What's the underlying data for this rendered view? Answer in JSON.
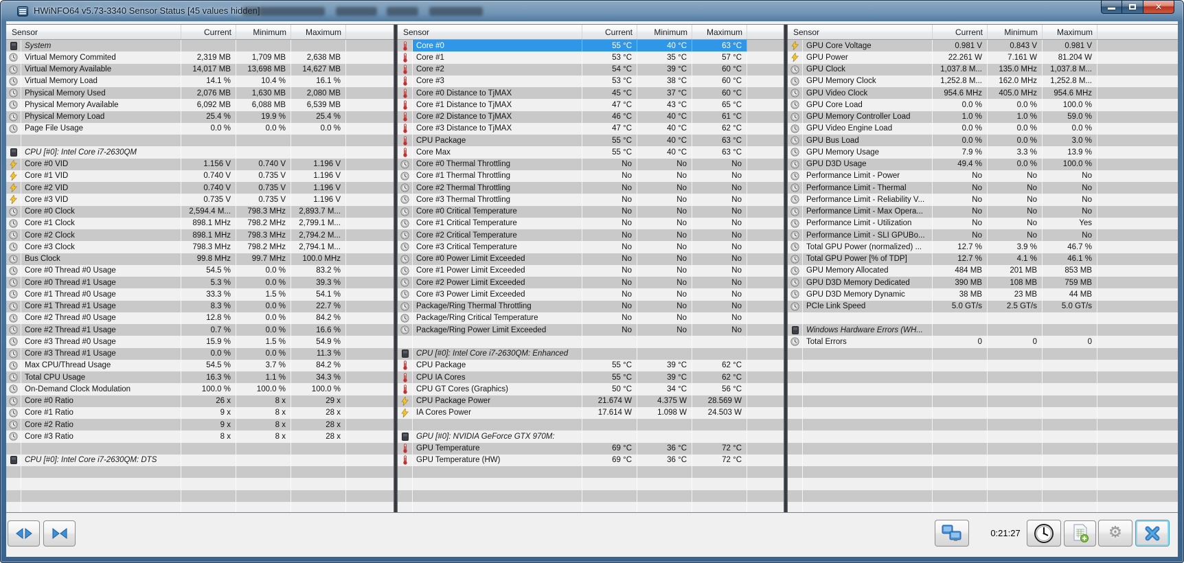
{
  "window": {
    "title": "HWiNFO64 v5.73-3340 Sensor Status [45 values hidden]",
    "controls": {
      "minimize": "minimize",
      "maximize": "maximize",
      "close": "close"
    }
  },
  "columns": {
    "sensor": "Sensor",
    "current": "Current",
    "minimum": "Minimum",
    "maximum": "Maximum"
  },
  "colors": {
    "stripe_light": "#f0f0f0",
    "stripe_dark": "#c9c9c9",
    "selection_blue": "#2f96e8",
    "titlebar_blue": "#47719a",
    "close_button_red": "#b73521",
    "bolt_yellow": "#f6c62d",
    "thermometer_red": "#c2312b"
  },
  "panels": [
    {
      "rows": [
        {
          "t": "h",
          "l": "System"
        },
        {
          "t": "i",
          "ic": "c",
          "l": "Virtual Memory Commited",
          "c": "2,319 MB",
          "m": "1,709 MB",
          "x": "2,638 MB"
        },
        {
          "t": "i",
          "ic": "c",
          "l": "Virtual Memory Available",
          "c": "14,017 MB",
          "m": "13,698 MB",
          "x": "14,627 MB"
        },
        {
          "t": "i",
          "ic": "c",
          "l": "Virtual Memory Load",
          "c": "14.1 %",
          "m": "10.4 %",
          "x": "16.1 %"
        },
        {
          "t": "i",
          "ic": "c",
          "l": "Physical Memory Used",
          "c": "2,076 MB",
          "m": "1,630 MB",
          "x": "2,080 MB"
        },
        {
          "t": "i",
          "ic": "c",
          "l": "Physical Memory Available",
          "c": "6,092 MB",
          "m": "6,088 MB",
          "x": "6,539 MB"
        },
        {
          "t": "i",
          "ic": "c",
          "l": "Physical Memory Load",
          "c": "25.4 %",
          "m": "19.9 %",
          "x": "25.4 %"
        },
        {
          "t": "i",
          "ic": "c",
          "l": "Page File Usage",
          "c": "0.0 %",
          "m": "0.0 %",
          "x": "0.0 %"
        },
        {
          "t": "b"
        },
        {
          "t": "h",
          "l": "CPU [#0]: Intel Core i7-2630QM"
        },
        {
          "t": "i",
          "ic": "b",
          "l": "Core #0 VID",
          "c": "1.156 V",
          "m": "0.740 V",
          "x": "1.196 V"
        },
        {
          "t": "i",
          "ic": "b",
          "l": "Core #1 VID",
          "c": "0.740 V",
          "m": "0.735 V",
          "x": "1.196 V"
        },
        {
          "t": "i",
          "ic": "b",
          "l": "Core #2 VID",
          "c": "0.740 V",
          "m": "0.735 V",
          "x": "1.196 V"
        },
        {
          "t": "i",
          "ic": "b",
          "l": "Core #3 VID",
          "c": "0.735 V",
          "m": "0.735 V",
          "x": "1.196 V"
        },
        {
          "t": "i",
          "ic": "c",
          "l": "Core #0 Clock",
          "c": "2,594.4 M...",
          "m": "798.3 MHz",
          "x": "2,893.7 M..."
        },
        {
          "t": "i",
          "ic": "c",
          "l": "Core #1 Clock",
          "c": "898.1 MHz",
          "m": "798.2 MHz",
          "x": "2,799.1 M..."
        },
        {
          "t": "i",
          "ic": "c",
          "l": "Core #2 Clock",
          "c": "898.1 MHz",
          "m": "798.3 MHz",
          "x": "2,794.2 M..."
        },
        {
          "t": "i",
          "ic": "c",
          "l": "Core #3 Clock",
          "c": "798.3 MHz",
          "m": "798.2 MHz",
          "x": "2,794.1 M..."
        },
        {
          "t": "i",
          "ic": "c",
          "l": "Bus Clock",
          "c": "99.8 MHz",
          "m": "99.7 MHz",
          "x": "100.0 MHz"
        },
        {
          "t": "i",
          "ic": "c",
          "l": "Core #0 Thread #0 Usage",
          "c": "54.5 %",
          "m": "0.0 %",
          "x": "83.2 %"
        },
        {
          "t": "i",
          "ic": "c",
          "l": "Core #0 Thread #1 Usage",
          "c": "5.3 %",
          "m": "0.0 %",
          "x": "39.3 %"
        },
        {
          "t": "i",
          "ic": "c",
          "l": "Core #1 Thread #0 Usage",
          "c": "33.3 %",
          "m": "1.5 %",
          "x": "54.1 %"
        },
        {
          "t": "i",
          "ic": "c",
          "l": "Core #1 Thread #1 Usage",
          "c": "8.3 %",
          "m": "0.0 %",
          "x": "22.7 %"
        },
        {
          "t": "i",
          "ic": "c",
          "l": "Core #2 Thread #0 Usage",
          "c": "12.8 %",
          "m": "0.0 %",
          "x": "84.2 %"
        },
        {
          "t": "i",
          "ic": "c",
          "l": "Core #2 Thread #1 Usage",
          "c": "0.7 %",
          "m": "0.0 %",
          "x": "16.6 %"
        },
        {
          "t": "i",
          "ic": "c",
          "l": "Core #3 Thread #0 Usage",
          "c": "15.9 %",
          "m": "1.5 %",
          "x": "54.9 %"
        },
        {
          "t": "i",
          "ic": "c",
          "l": "Core #3 Thread #1 Usage",
          "c": "0.0 %",
          "m": "0.0 %",
          "x": "11.3 %"
        },
        {
          "t": "i",
          "ic": "c",
          "l": "Max CPU/Thread Usage",
          "c": "54.5 %",
          "m": "3.7 %",
          "x": "84.2 %"
        },
        {
          "t": "i",
          "ic": "c",
          "l": "Total CPU Usage",
          "c": "16.3 %",
          "m": "1.1 %",
          "x": "34.3 %"
        },
        {
          "t": "i",
          "ic": "c",
          "l": "On-Demand Clock Modulation",
          "c": "100.0 %",
          "m": "100.0 %",
          "x": "100.0 %"
        },
        {
          "t": "i",
          "ic": "c",
          "l": "Core #0 Ratio",
          "c": "26 x",
          "m": "8 x",
          "x": "29 x"
        },
        {
          "t": "i",
          "ic": "c",
          "l": "Core #1 Ratio",
          "c": "9 x",
          "m": "8 x",
          "x": "28 x"
        },
        {
          "t": "i",
          "ic": "c",
          "l": "Core #2 Ratio",
          "c": "9 x",
          "m": "8 x",
          "x": "28 x"
        },
        {
          "t": "i",
          "ic": "c",
          "l": "Core #3 Ratio",
          "c": "8 x",
          "m": "8 x",
          "x": "28 x"
        },
        {
          "t": "b"
        },
        {
          "t": "h",
          "l": "CPU [#0]: Intel Core i7-2630QM: DTS"
        },
        {
          "t": "b"
        },
        {
          "t": "b"
        },
        {
          "t": "b"
        },
        {
          "t": "b"
        }
      ]
    },
    {
      "rows": [
        {
          "t": "i",
          "ic": "t",
          "l": "Core #0",
          "c": "55 °C",
          "m": "40 °C",
          "x": "63 °C",
          "sel": true
        },
        {
          "t": "i",
          "ic": "t",
          "l": "Core #1",
          "c": "53 °C",
          "m": "35 °C",
          "x": "57 °C"
        },
        {
          "t": "i",
          "ic": "t",
          "l": "Core #2",
          "c": "54 °C",
          "m": "39 °C",
          "x": "60 °C"
        },
        {
          "t": "i",
          "ic": "t",
          "l": "Core #3",
          "c": "53 °C",
          "m": "38 °C",
          "x": "60 °C"
        },
        {
          "t": "i",
          "ic": "t",
          "l": "Core #0 Distance to TjMAX",
          "c": "45 °C",
          "m": "37 °C",
          "x": "60 °C"
        },
        {
          "t": "i",
          "ic": "t",
          "l": "Core #1 Distance to TjMAX",
          "c": "47 °C",
          "m": "43 °C",
          "x": "65 °C"
        },
        {
          "t": "i",
          "ic": "t",
          "l": "Core #2 Distance to TjMAX",
          "c": "46 °C",
          "m": "40 °C",
          "x": "61 °C"
        },
        {
          "t": "i",
          "ic": "t",
          "l": "Core #3 Distance to TjMAX",
          "c": "47 °C",
          "m": "40 °C",
          "x": "62 °C"
        },
        {
          "t": "i",
          "ic": "t",
          "l": "CPU Package",
          "c": "55 °C",
          "m": "40 °C",
          "x": "63 °C"
        },
        {
          "t": "i",
          "ic": "t",
          "l": "Core Max",
          "c": "55 °C",
          "m": "40 °C",
          "x": "63 °C"
        },
        {
          "t": "i",
          "ic": "c",
          "l": "Core #0 Thermal Throttling",
          "c": "No",
          "m": "No",
          "x": "No"
        },
        {
          "t": "i",
          "ic": "c",
          "l": "Core #1 Thermal Throttling",
          "c": "No",
          "m": "No",
          "x": "No"
        },
        {
          "t": "i",
          "ic": "c",
          "l": "Core #2 Thermal Throttling",
          "c": "No",
          "m": "No",
          "x": "No"
        },
        {
          "t": "i",
          "ic": "c",
          "l": "Core #3 Thermal Throttling",
          "c": "No",
          "m": "No",
          "x": "No"
        },
        {
          "t": "i",
          "ic": "c",
          "l": "Core #0 Critical Temperature",
          "c": "No",
          "m": "No",
          "x": "No"
        },
        {
          "t": "i",
          "ic": "c",
          "l": "Core #1 Critical Temperature",
          "c": "No",
          "m": "No",
          "x": "No"
        },
        {
          "t": "i",
          "ic": "c",
          "l": "Core #2 Critical Temperature",
          "c": "No",
          "m": "No",
          "x": "No"
        },
        {
          "t": "i",
          "ic": "c",
          "l": "Core #3 Critical Temperature",
          "c": "No",
          "m": "No",
          "x": "No"
        },
        {
          "t": "i",
          "ic": "c",
          "l": "Core #0 Power Limit Exceeded",
          "c": "No",
          "m": "No",
          "x": "No"
        },
        {
          "t": "i",
          "ic": "c",
          "l": "Core #1 Power Limit Exceeded",
          "c": "No",
          "m": "No",
          "x": "No"
        },
        {
          "t": "i",
          "ic": "c",
          "l": "Core #2 Power Limit Exceeded",
          "c": "No",
          "m": "No",
          "x": "No"
        },
        {
          "t": "i",
          "ic": "c",
          "l": "Core #3 Power Limit Exceeded",
          "c": "No",
          "m": "No",
          "x": "No"
        },
        {
          "t": "i",
          "ic": "c",
          "l": "Package/Ring Thermal Throttling",
          "c": "No",
          "m": "No",
          "x": "No"
        },
        {
          "t": "i",
          "ic": "c",
          "l": "Package/Ring Critical Temperature",
          "c": "No",
          "m": "No",
          "x": "No"
        },
        {
          "t": "i",
          "ic": "c",
          "l": "Package/Ring Power Limit Exceeded",
          "c": "No",
          "m": "No",
          "x": "No"
        },
        {
          "t": "b"
        },
        {
          "t": "h",
          "l": "CPU [#0]: Intel Core i7-2630QM: Enhanced"
        },
        {
          "t": "i",
          "ic": "t",
          "l": "CPU Package",
          "c": "55 °C",
          "m": "39 °C",
          "x": "62 °C"
        },
        {
          "t": "i",
          "ic": "t",
          "l": "CPU IA Cores",
          "c": "55 °C",
          "m": "39 °C",
          "x": "62 °C"
        },
        {
          "t": "i",
          "ic": "t",
          "l": "CPU GT Cores (Graphics)",
          "c": "50 °C",
          "m": "34 °C",
          "x": "56 °C"
        },
        {
          "t": "i",
          "ic": "b",
          "l": "CPU Package Power",
          "c": "21.674 W",
          "m": "4.375 W",
          "x": "28.569 W"
        },
        {
          "t": "i",
          "ic": "b",
          "l": "IA Cores Power",
          "c": "17.614 W",
          "m": "1.098 W",
          "x": "24.503 W"
        },
        {
          "t": "b"
        },
        {
          "t": "h",
          "l": "GPU [#0]: NVIDIA GeForce GTX 970M:"
        },
        {
          "t": "i",
          "ic": "t",
          "l": "GPU Temperature",
          "c": "69 °C",
          "m": "36 °C",
          "x": "72 °C"
        },
        {
          "t": "i",
          "ic": "t",
          "l": "GPU Temperature (HW)",
          "c": "69 °C",
          "m": "36 °C",
          "x": "72 °C"
        },
        {
          "t": "b"
        },
        {
          "t": "b"
        },
        {
          "t": "b"
        },
        {
          "t": "b"
        }
      ]
    },
    {
      "rows": [
        {
          "t": "i",
          "ic": "b",
          "l": "GPU Core Voltage",
          "c": "0.981 V",
          "m": "0.843 V",
          "x": "0.981 V"
        },
        {
          "t": "i",
          "ic": "b",
          "l": "GPU Power",
          "c": "22.261 W",
          "m": "7.161 W",
          "x": "81.204 W"
        },
        {
          "t": "i",
          "ic": "c",
          "l": "GPU Clock",
          "c": "1,037.8 M...",
          "m": "135.0 MHz",
          "x": "1,037.8 M..."
        },
        {
          "t": "i",
          "ic": "c",
          "l": "GPU Memory Clock",
          "c": "1,252.8 M...",
          "m": "162.0 MHz",
          "x": "1,252.8 M..."
        },
        {
          "t": "i",
          "ic": "c",
          "l": "GPU Video Clock",
          "c": "954.6 MHz",
          "m": "405.0 MHz",
          "x": "954.6 MHz"
        },
        {
          "t": "i",
          "ic": "c",
          "l": "GPU Core Load",
          "c": "0.0 %",
          "m": "0.0 %",
          "x": "100.0 %"
        },
        {
          "t": "i",
          "ic": "c",
          "l": "GPU Memory Controller Load",
          "c": "1.0 %",
          "m": "1.0 %",
          "x": "59.0 %"
        },
        {
          "t": "i",
          "ic": "c",
          "l": "GPU Video Engine Load",
          "c": "0.0 %",
          "m": "0.0 %",
          "x": "0.0 %"
        },
        {
          "t": "i",
          "ic": "c",
          "l": "GPU Bus Load",
          "c": "0.0 %",
          "m": "0.0 %",
          "x": "3.0 %"
        },
        {
          "t": "i",
          "ic": "c",
          "l": "GPU Memory Usage",
          "c": "7.9 %",
          "m": "3.3 %",
          "x": "13.9 %"
        },
        {
          "t": "i",
          "ic": "c",
          "l": "GPU D3D Usage",
          "c": "49.4 %",
          "m": "0.0 %",
          "x": "100.0 %"
        },
        {
          "t": "i",
          "ic": "c",
          "l": "Performance Limit - Power",
          "c": "No",
          "m": "No",
          "x": "No"
        },
        {
          "t": "i",
          "ic": "c",
          "l": "Performance Limit - Thermal",
          "c": "No",
          "m": "No",
          "x": "No"
        },
        {
          "t": "i",
          "ic": "c",
          "l": "Performance Limit - Reliability V...",
          "c": "No",
          "m": "No",
          "x": "No"
        },
        {
          "t": "i",
          "ic": "c",
          "l": "Performance Limit - Max Opera...",
          "c": "No",
          "m": "No",
          "x": "No"
        },
        {
          "t": "i",
          "ic": "c",
          "l": "Performance Limit - Utilization",
          "c": "No",
          "m": "No",
          "x": "Yes"
        },
        {
          "t": "i",
          "ic": "c",
          "l": "Performance Limit - SLI GPUBo...",
          "c": "No",
          "m": "No",
          "x": "No"
        },
        {
          "t": "i",
          "ic": "c",
          "l": "Total GPU Power (normalized) ...",
          "c": "12.7 %",
          "m": "3.9 %",
          "x": "46.7 %"
        },
        {
          "t": "i",
          "ic": "c",
          "l": "Total GPU Power [% of TDP]",
          "c": "12.7 %",
          "m": "4.1 %",
          "x": "46.1 %"
        },
        {
          "t": "i",
          "ic": "c",
          "l": "GPU Memory Allocated",
          "c": "484 MB",
          "m": "201 MB",
          "x": "853 MB"
        },
        {
          "t": "i",
          "ic": "c",
          "l": "GPU D3D Memory Dedicated",
          "c": "390 MB",
          "m": "108 MB",
          "x": "759 MB"
        },
        {
          "t": "i",
          "ic": "c",
          "l": "GPU D3D Memory Dynamic",
          "c": "38 MB",
          "m": "23 MB",
          "x": "44 MB"
        },
        {
          "t": "i",
          "ic": "c",
          "l": "PCIe Link Speed",
          "c": "5.0 GT/s",
          "m": "2.5 GT/s",
          "x": "5.0 GT/s"
        },
        {
          "t": "b"
        },
        {
          "t": "h",
          "l": "Windows Hardware Errors (WH..."
        },
        {
          "t": "i",
          "ic": "c",
          "l": "Total Errors",
          "c": "0",
          "m": "0",
          "x": "0"
        },
        {
          "t": "b"
        },
        {
          "t": "b"
        },
        {
          "t": "b"
        },
        {
          "t": "b"
        },
        {
          "t": "b"
        },
        {
          "t": "b"
        },
        {
          "t": "b"
        },
        {
          "t": "b"
        },
        {
          "t": "b"
        },
        {
          "t": "b"
        },
        {
          "t": "b"
        },
        {
          "t": "b"
        },
        {
          "t": "b"
        },
        {
          "t": "b"
        }
      ]
    }
  ],
  "toolbar": {
    "time": "0:21:27",
    "buttons": {
      "widen_window": "widen-window",
      "narrow_window": "narrow-window",
      "remote_monitoring": "remote-monitoring",
      "reset_clock": "reset-clock",
      "logging": "start-logging",
      "settings": "settings",
      "close": "close"
    }
  }
}
